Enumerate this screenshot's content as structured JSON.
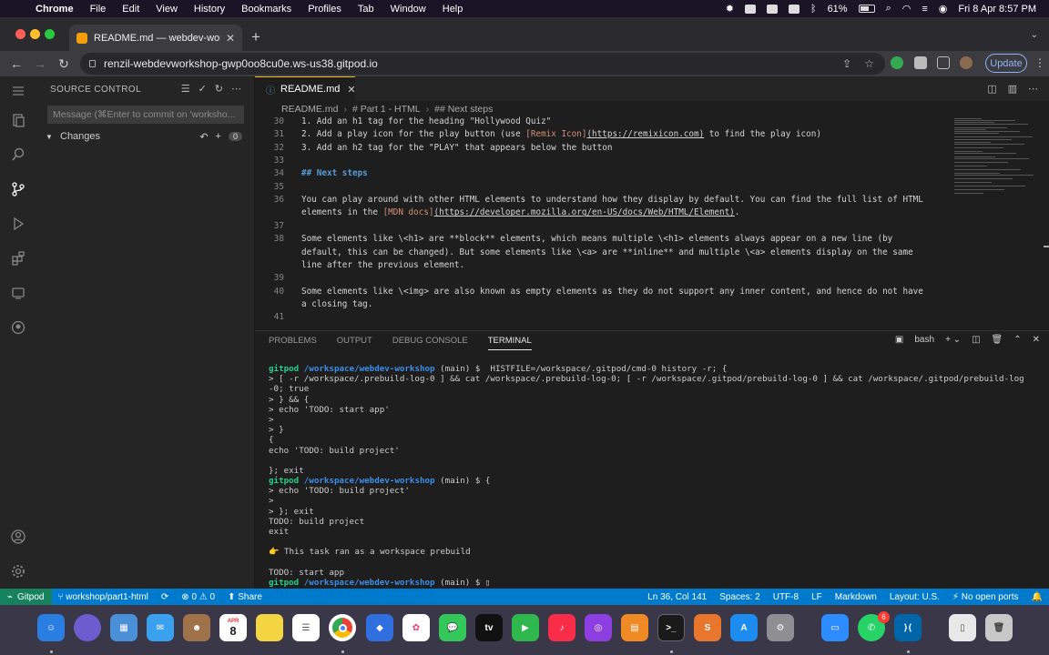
{
  "menubar": {
    "app": "Chrome",
    "items": [
      "File",
      "Edit",
      "View",
      "History",
      "Bookmarks",
      "Profiles",
      "Tab",
      "Window",
      "Help"
    ],
    "battery": "61%",
    "datetime": "Fri 8 Apr  8:57 PM"
  },
  "browser": {
    "tab_title": "README.md — webdev-worksh",
    "url": "renzil-webdevworkshop-gwp0oo8cu0e.ws-us38.gitpod.io",
    "update_label": "Update"
  },
  "sidebar": {
    "title": "SOURCE CONTROL",
    "commit_placeholder": "Message (⌘Enter to commit on 'worksho...",
    "changes_label": "Changes",
    "changes_count": "0"
  },
  "editor": {
    "tab_label": "README.md",
    "breadcrumb": [
      "README.md",
      "# Part 1 - HTML",
      "## Next steps"
    ],
    "lines": [
      {
        "n": "30",
        "text": "1. Add an h1 tag for the heading \"Hollywood Quiz\""
      },
      {
        "n": "31",
        "pre": "2. Add a play icon for the play button (use ",
        "link": "[Remix Icon]",
        "url": "(https://remixicon.com)",
        "post": " to find the play icon)"
      },
      {
        "n": "32",
        "text": "3. Add an h2 tag for the \"PLAY\" that appears below the button"
      },
      {
        "n": "33",
        "text": ""
      },
      {
        "n": "34",
        "heading": "## Next steps"
      },
      {
        "n": "35",
        "text": ""
      },
      {
        "n": "36",
        "text": "You can play around with other HTML elements to understand how they display by default. You can find the full list of HTML"
      },
      {
        "n": "",
        "pre": "elements in the ",
        "link": "[MDN docs]",
        "url": "(https://developer.mozilla.org/en-US/docs/Web/HTML/Element)",
        "post": "."
      },
      {
        "n": "37",
        "text": ""
      },
      {
        "n": "38",
        "text": "Some elements like \\<h1> are **block** elements, which means multiple \\<h1> elements always appear on a new line (by"
      },
      {
        "n": "",
        "text": "default, this can be changed). But some elements like \\<a> are **inline** and multiple \\<a> elements display on the same"
      },
      {
        "n": "",
        "text": "line after the previous element."
      },
      {
        "n": "39",
        "text": ""
      },
      {
        "n": "40",
        "text": "Some elements like \\<img> are also known as empty elements as they do not support any inner content, and hence do not have"
      },
      {
        "n": "",
        "text": "a closing tag."
      },
      {
        "n": "41",
        "text": ""
      }
    ]
  },
  "panel": {
    "tabs": [
      "PROBLEMS",
      "OUTPUT",
      "DEBUG CONSOLE",
      "TERMINAL"
    ],
    "active_tab": "TERMINAL",
    "shell": "bash",
    "terminal_lines": [
      {
        "user": "gitpod",
        "path": "/workspace/webdev-workshop",
        "rest": " (main) $  HISTFILE=/workspace/.gitpod/cmd-0 history -r; {"
      },
      {
        "text": "> [ -r /workspace/.prebuild-log-0 ] && cat /workspace/.prebuild-log-0; [ -r /workspace/.gitpod/prebuild-log-0 ] && cat /workspace/.gitpod/prebuild-log"
      },
      {
        "text": "-0; true"
      },
      {
        "text": "> } && {"
      },
      {
        "text": "> echo 'TODO: start app'"
      },
      {
        "text": ">"
      },
      {
        "text": "> }"
      },
      {
        "text": "{"
      },
      {
        "text": "echo 'TODO: build project'"
      },
      {
        "text": ""
      },
      {
        "text": "}; exit"
      },
      {
        "user": "gitpod",
        "path": "/workspace/webdev-workshop",
        "rest": " (main) $ {"
      },
      {
        "text": "> echo 'TODO: build project'"
      },
      {
        "text": ">"
      },
      {
        "text": "> }; exit"
      },
      {
        "text": "TODO: build project"
      },
      {
        "text": "exit"
      },
      {
        "text": ""
      },
      {
        "text": "👉 This task ran as a workspace prebuild"
      },
      {
        "text": ""
      },
      {
        "text": "TODO: start app"
      },
      {
        "user": "gitpod",
        "path": "/workspace/webdev-workshop",
        "rest": " (main) $ ▯"
      }
    ]
  },
  "statusbar": {
    "remote": "Gitpod",
    "branch": "workshop/part1-html",
    "errors": "0",
    "warnings": "0",
    "share": "Share",
    "position": "Ln 36, Col 141",
    "spaces": "Spaces: 2",
    "encoding": "UTF-8",
    "eol": "LF",
    "language": "Markdown",
    "layout": "Layout: U.S.",
    "ports": "No open ports"
  },
  "dock": {
    "calendar_month": "APR",
    "calendar_day": "8",
    "facetime_badge": "6"
  }
}
